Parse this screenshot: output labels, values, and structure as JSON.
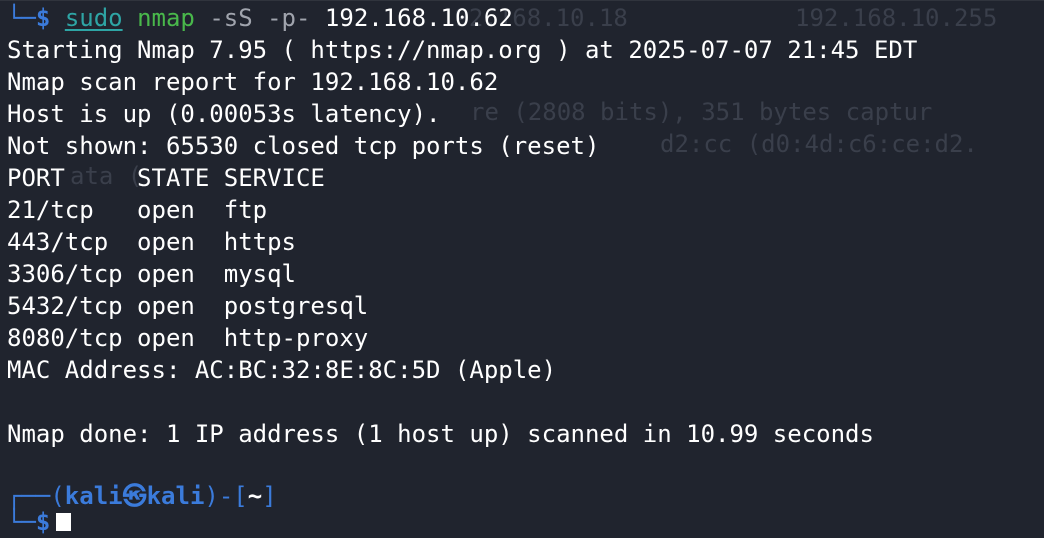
{
  "terminal": {
    "colors": {
      "background": "#20242e",
      "prompt_blue": "#3b7bdb",
      "sudo_cyan": "#2ea5a5",
      "command_green": "#49b84b",
      "args_gray": "#a0a4ad",
      "text": "#ffffff"
    },
    "ghost_text": {
      "line1_ip": "192.168.10.18",
      "line1_ip2": "192.168.10.255",
      "line2": "re (2808 bits), 351 bytes captur",
      "line3": "d2:cc (d0:4d:c6:ce:d2.",
      "line4": "ata ("
    },
    "command_line": {
      "prompt_prefix": "└─",
      "dollar": "$",
      "sudo": "sudo",
      "nmap": "nmap",
      "flags": "-sS -p-",
      "target": "192.168.10.62"
    },
    "output": [
      "Starting Nmap 7.95 ( https://nmap.org ) at 2025-07-07 21:45 EDT",
      "Nmap scan report for 192.168.10.62",
      "Host is up (0.00053s latency).",
      "Not shown: 65530 closed tcp ports (reset)",
      "PORT     STATE SERVICE",
      "21/tcp   open  ftp",
      "443/tcp  open  https",
      "3306/tcp open  mysql",
      "5432/tcp open  postgresql",
      "8080/tcp open  http-proxy",
      "MAC Address: AC:BC:32:8E:8C:5D (Apple)",
      "",
      "Nmap done: 1 IP address (1 host up) scanned in 10.99 seconds"
    ],
    "prompt": {
      "top_prefix": "┌──(",
      "user": "kali",
      "at_symbol": "㉿",
      "host": "kali",
      "mid": ")-[",
      "cwd": "~",
      "close": "]",
      "bottom_prefix": "└─",
      "dollar": "$"
    }
  }
}
